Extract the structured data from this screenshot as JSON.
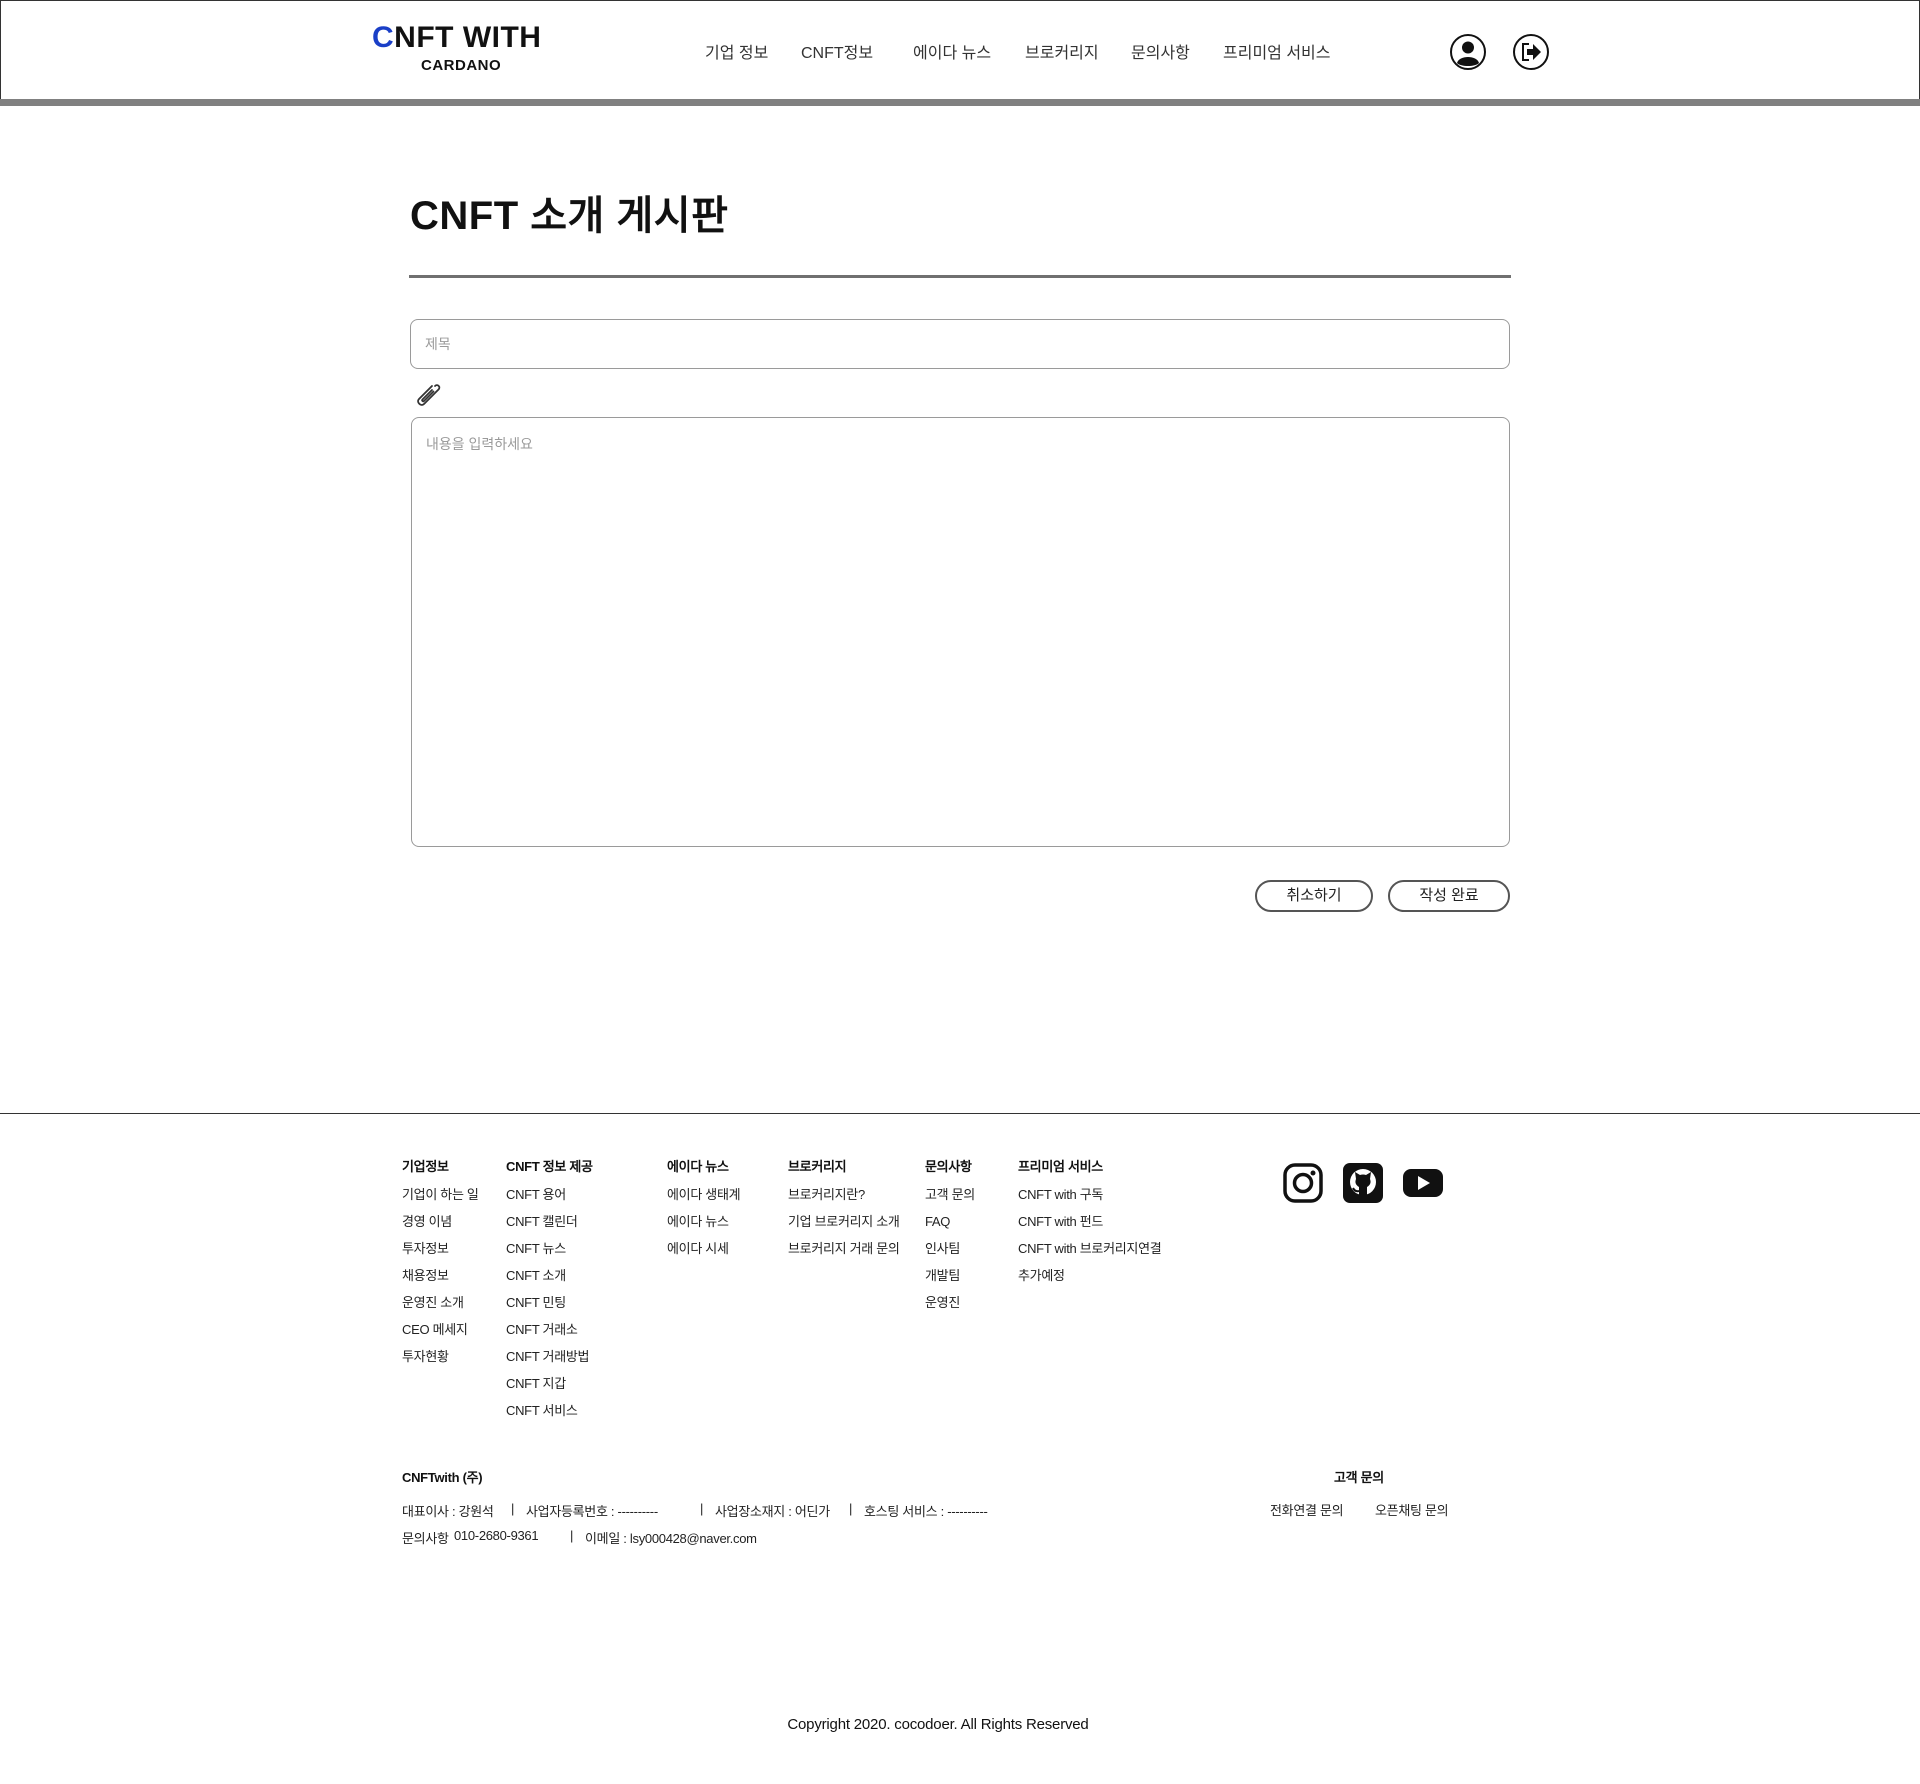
{
  "header": {
    "logo_first_letter": "C",
    "logo_rest": "NFT WITH",
    "logo_sub": "CARDANO",
    "nav": [
      "기업 정보",
      "CNFT정보",
      "에이다 뉴스",
      "브로커리지",
      "문의사항",
      "프리미엄 서비스"
    ],
    "icons": [
      "user-icon",
      "logout-icon"
    ]
  },
  "main": {
    "title": "CNFT 소개 게시판",
    "title_placeholder": "제목",
    "content_placeholder": "내용을 입력하세요",
    "cancel_label": "취소하기",
    "submit_label": "작성 완료"
  },
  "footer": {
    "columns": [
      {
        "heading": "기업정보",
        "items": [
          "기업이 하는 일",
          "경영 이념",
          "투자정보",
          "채용정보",
          "운영진 소개",
          "CEO 메세지",
          "투자현황"
        ]
      },
      {
        "heading": "CNFT 정보 제공",
        "items": [
          "CNFT 용어",
          "CNFT 캘린더",
          "CNFT 뉴스",
          "CNFT 소개",
          "CNFT 민팅",
          "CNFT 거래소",
          "CNFT 거래방법",
          "CNFT 지갑",
          "CNFT 서비스"
        ]
      },
      {
        "heading": "에이다 뉴스",
        "items": [
          "에이다 생태계",
          "에이다 뉴스",
          "에이다 시세"
        ]
      },
      {
        "heading": "브로커리지",
        "items": [
          "브로커리지란?",
          "기업 브로커리지 소개",
          "브로커리지 거래 문의"
        ]
      },
      {
        "heading": "문의사항",
        "items": [
          "고객 문의",
          "FAQ",
          "인사팀",
          "개발팀",
          "운영진"
        ]
      },
      {
        "heading": "프리미엄 서비스",
        "items": [
          "CNFT with 구독",
          "CNFT with 펀드",
          "CNFT with 브로커리지연결",
          "추가예정"
        ]
      }
    ],
    "social": [
      "instagram-icon",
      "github-icon",
      "youtube-icon"
    ],
    "company": "CNFTwith (주)",
    "ceo": "대표이사 : 강원석",
    "biz_no": "사업자등록번호 : ----------",
    "address": "사업장소재지 : 어딘가",
    "hosting": "호스팅 서비스 : ----------",
    "phone_label": "문의사항",
    "phone": "010-2680-9361",
    "email": "이메일 : lsy000428@naver.com",
    "sep": "|",
    "support_title": "고객 문의",
    "phone_support": "전화연결 문의",
    "chat_support": "오픈채팅 문의",
    "copyright": "Copyright 2020. cocodoer. All Rights Reserved"
  }
}
